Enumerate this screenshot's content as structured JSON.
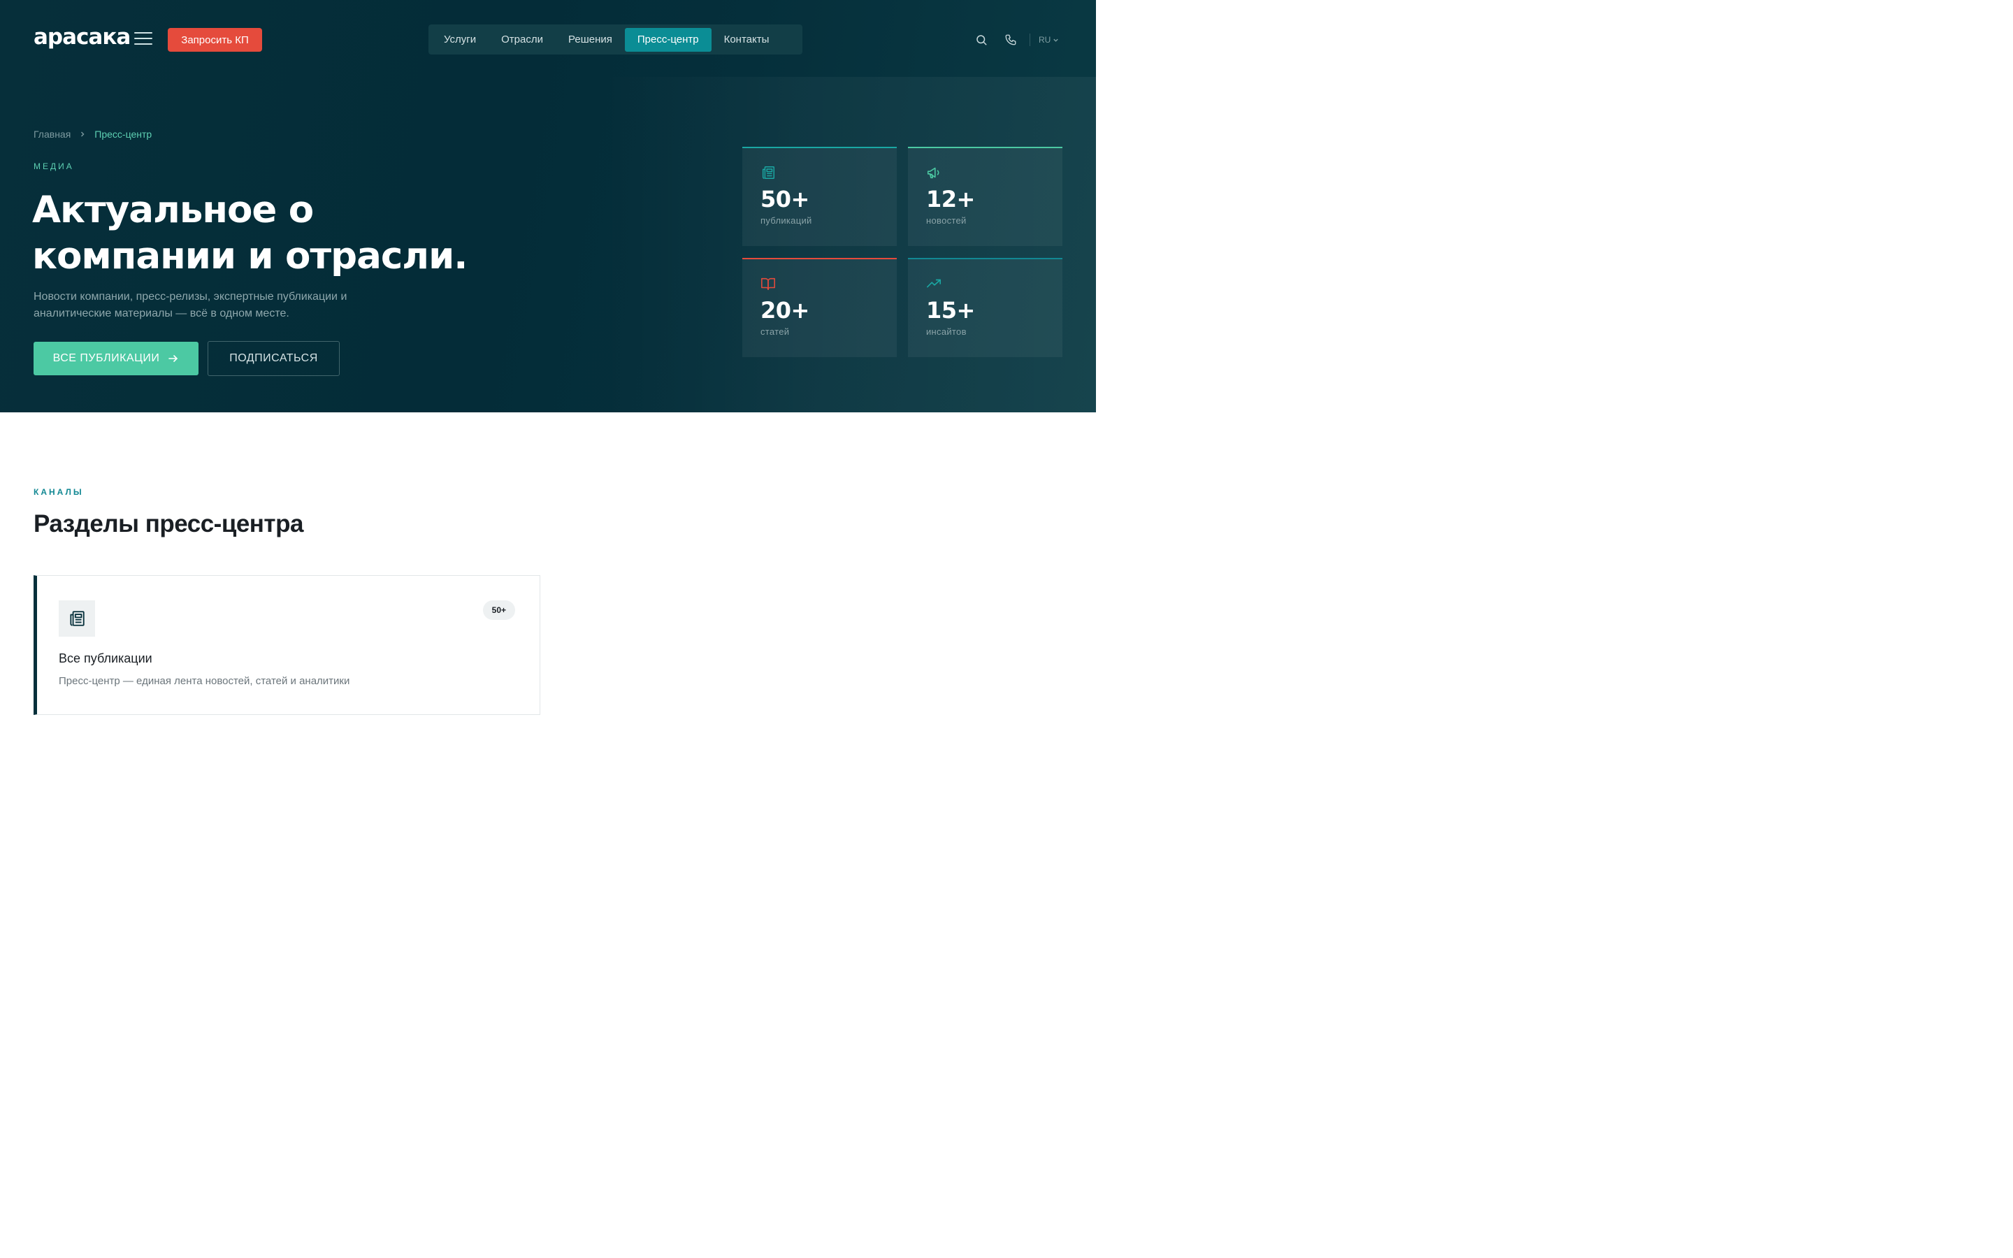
{
  "header": {
    "logo": "арасака",
    "cta": "Запросить КП",
    "nav": [
      {
        "label": "Услуги"
      },
      {
        "label": "Отрасли"
      },
      {
        "label": "Решения"
      },
      {
        "label": "Пресс-центр"
      },
      {
        "label": "Контакты"
      }
    ],
    "active_nav": "Пресс-центр",
    "lang": "RU"
  },
  "breadcrumb": {
    "home": "Главная",
    "current": "Пресс-центр"
  },
  "hero": {
    "eyebrow": "МЕДИА",
    "title_line1": "Актуальное о",
    "title_line2": "компании и отрасли.",
    "subtitle": "Новости компании, пресс-релизы, экспертные публикации и аналитические материалы — всё в одном месте.",
    "primary_button": "ВСЕ ПУБЛИКАЦИИ",
    "secondary_button": "ПОДПИСАТЬСЯ"
  },
  "stats": [
    {
      "value": "50+",
      "label": "публикаций",
      "icon": "newspaper-icon",
      "color": "#1aa7a3"
    },
    {
      "value": "12+",
      "label": "новостей",
      "icon": "megaphone-icon",
      "color": "#4cc9a3"
    },
    {
      "value": "20+",
      "label": "статей",
      "icon": "book-icon",
      "color": "#e54b3c"
    },
    {
      "value": "15+",
      "label": "инсайтов",
      "icon": "trending-up-icon",
      "color": "#128893"
    }
  ],
  "section": {
    "eyebrow": "КАНАЛЫ",
    "title": "Разделы пресс-центра"
  },
  "card": {
    "title": "Все публикации",
    "badge": "50+",
    "description": "Пресс-центр — единая лента новостей, статей и аналитики",
    "icon": "newspaper-icon"
  },
  "colors": {
    "hero_bg": "#052f3b",
    "accent_red": "#e54b3c",
    "accent_green": "#4cc9a3",
    "accent_teal": "#0b8d95"
  }
}
